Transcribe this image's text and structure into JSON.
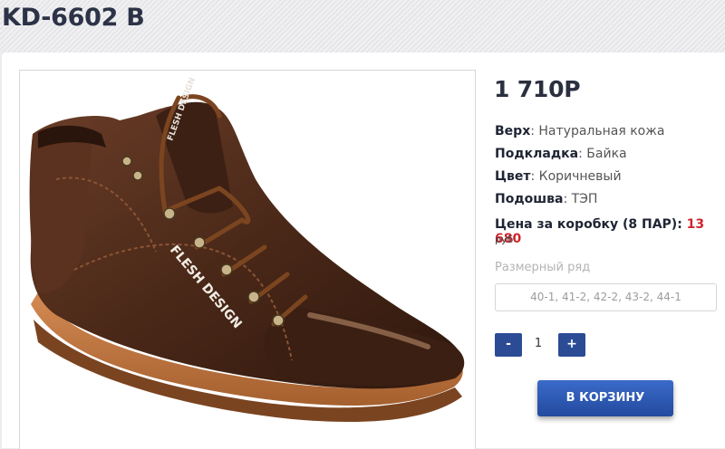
{
  "product": {
    "title": "KD-6602 B",
    "price": "1 710Р",
    "specs": [
      {
        "label": "Верх",
        "value": "Натуральная кожа"
      },
      {
        "label": "Подкладка",
        "value": "Байка"
      },
      {
        "label": "Цвет",
        "value": "Коричневый"
      },
      {
        "label": "Подошва",
        "value": "ТЭП"
      }
    ],
    "box_price_label": "Цена за коробку (8 ПАР):",
    "box_price_value": "13 680",
    "box_price_unit": "руб",
    "image_brand_text_tongue": "FLESH DESIGN",
    "image_brand_text_side": "FLESH DESIGN"
  },
  "size": {
    "label": "Размерный ряд",
    "value": "40-1, 41-2, 42-2, 43-2, 44-1"
  },
  "quantity": {
    "minus": "-",
    "value": "1",
    "plus": "+"
  },
  "cart_button": "В КОРЗИНУ",
  "colors": {
    "title": "#2c3347",
    "accent_button": "#2b4c95",
    "box_price": "#d0252d",
    "background": "#ececee"
  }
}
